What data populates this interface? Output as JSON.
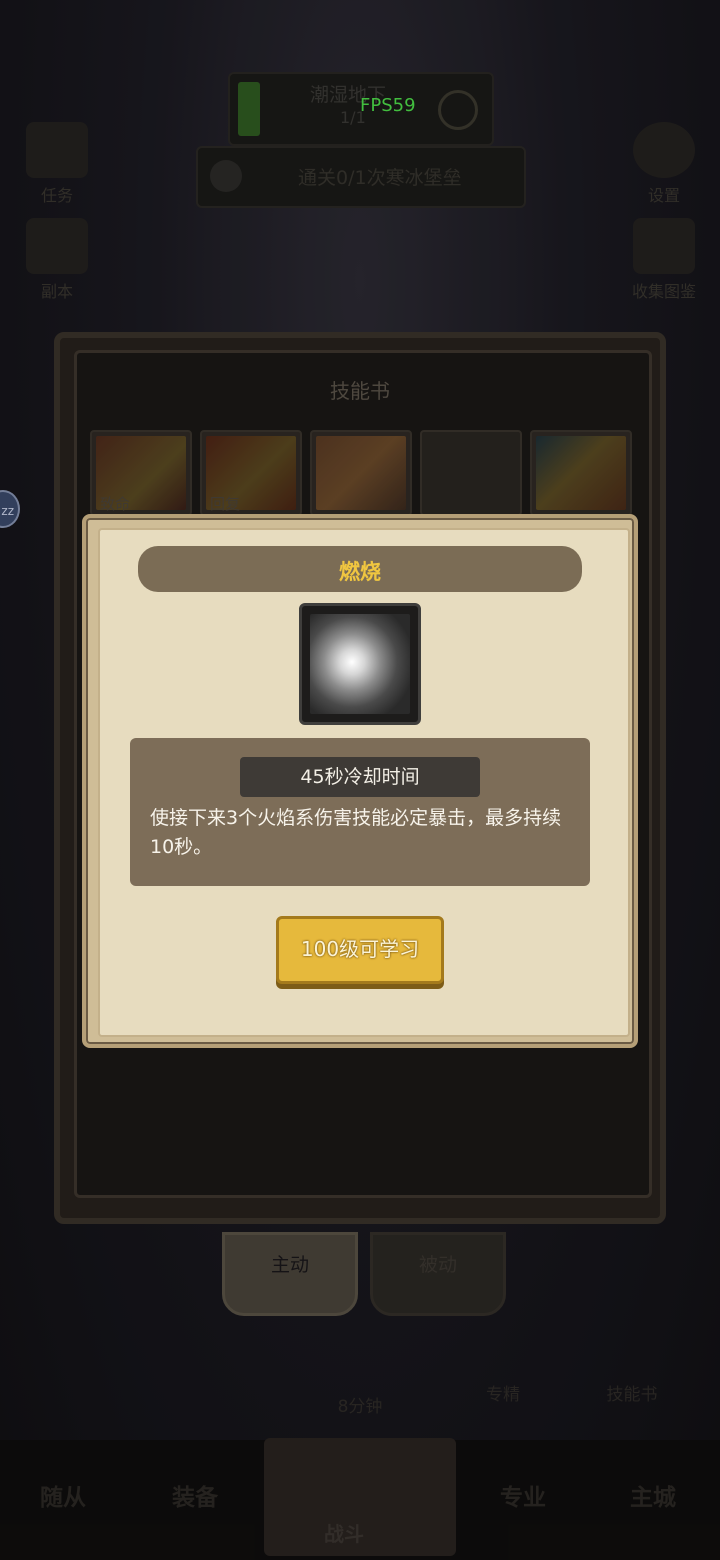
{
  "hud": {
    "hunt_title": "潮湿地下",
    "hunt_progress": "1/1",
    "fps": "FPS59",
    "quest": "通关0/1次寒冰堡垒"
  },
  "side_icons": {
    "left_top": "任务",
    "left_mid": "副本",
    "right_top": "设置",
    "right_mid": "收集图鉴"
  },
  "skill_book": {
    "title": "技能书",
    "slots": [
      {
        "label": "致命"
      },
      {
        "label": "回复"
      },
      {
        "label": ""
      },
      {
        "label": ""
      },
      {
        "label": ""
      }
    ],
    "tabs": {
      "active": "主动",
      "passive": "被动"
    }
  },
  "lower_row": {
    "timer": "8分钟",
    "specialty": "专精",
    "skillbook": "技能书"
  },
  "bottom_nav": {
    "followers": "随从",
    "equipment": "装备",
    "battle": "战斗",
    "profession": "专业",
    "main_city": "主城"
  },
  "notification_badge": "zz",
  "skill_modal": {
    "title": "燃烧",
    "icon": "fire-swirl-skill-icon",
    "cooldown": "45秒冷却时间",
    "description": "使接下来3个火焰系伤害技能必定暴击，最多持续10秒。",
    "learn_button": "100级可学习"
  },
  "colors": {
    "title_gold": "#f0c640",
    "button_gold": "#e6b93c",
    "fps_green": "#4ee04a"
  }
}
